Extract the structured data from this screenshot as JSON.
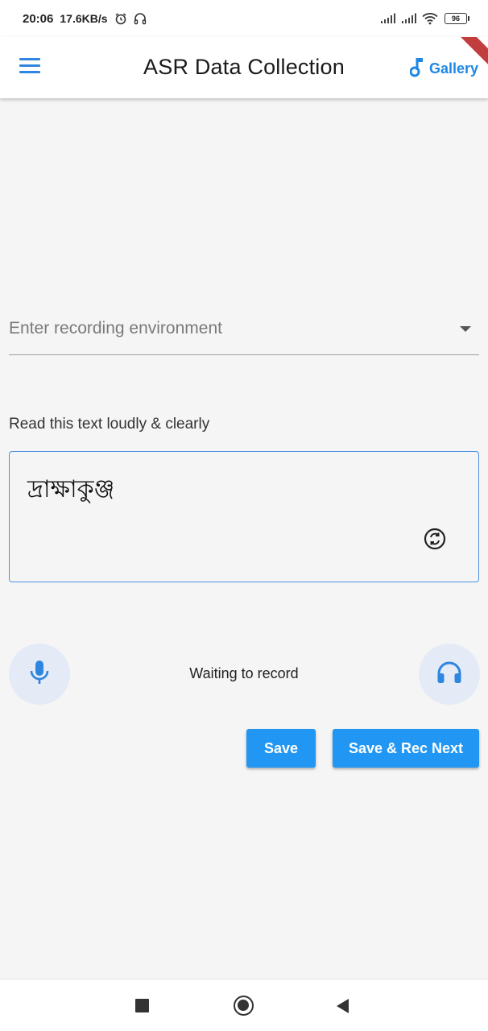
{
  "status_bar": {
    "time": "20:06",
    "network_speed": "17.6KB/s",
    "battery": "96",
    "icons": [
      "alarm-icon",
      "headset-icon",
      "signal-icon",
      "signal-icon",
      "wifi-icon",
      "battery-icon"
    ]
  },
  "app_bar": {
    "title": "ASR Data Collection",
    "gallery_label": "Gallery",
    "menu_icon": "hamburger-menu-icon",
    "gallery_icon": "music-note-icon"
  },
  "form": {
    "env_placeholder": "Enter recording environment",
    "instruction": "Read this text loudly & clearly",
    "prompt_text": "দ্রাক্ষাকুঞ্জ",
    "record_status": "Waiting to record"
  },
  "buttons": {
    "save": "Save",
    "save_next": "Save & Rec Next"
  },
  "colors": {
    "accent": "#2196f3",
    "icon_blue": "#1e88e5",
    "circle_bg": "#e4ebf6",
    "background": "#f5f5f5"
  }
}
